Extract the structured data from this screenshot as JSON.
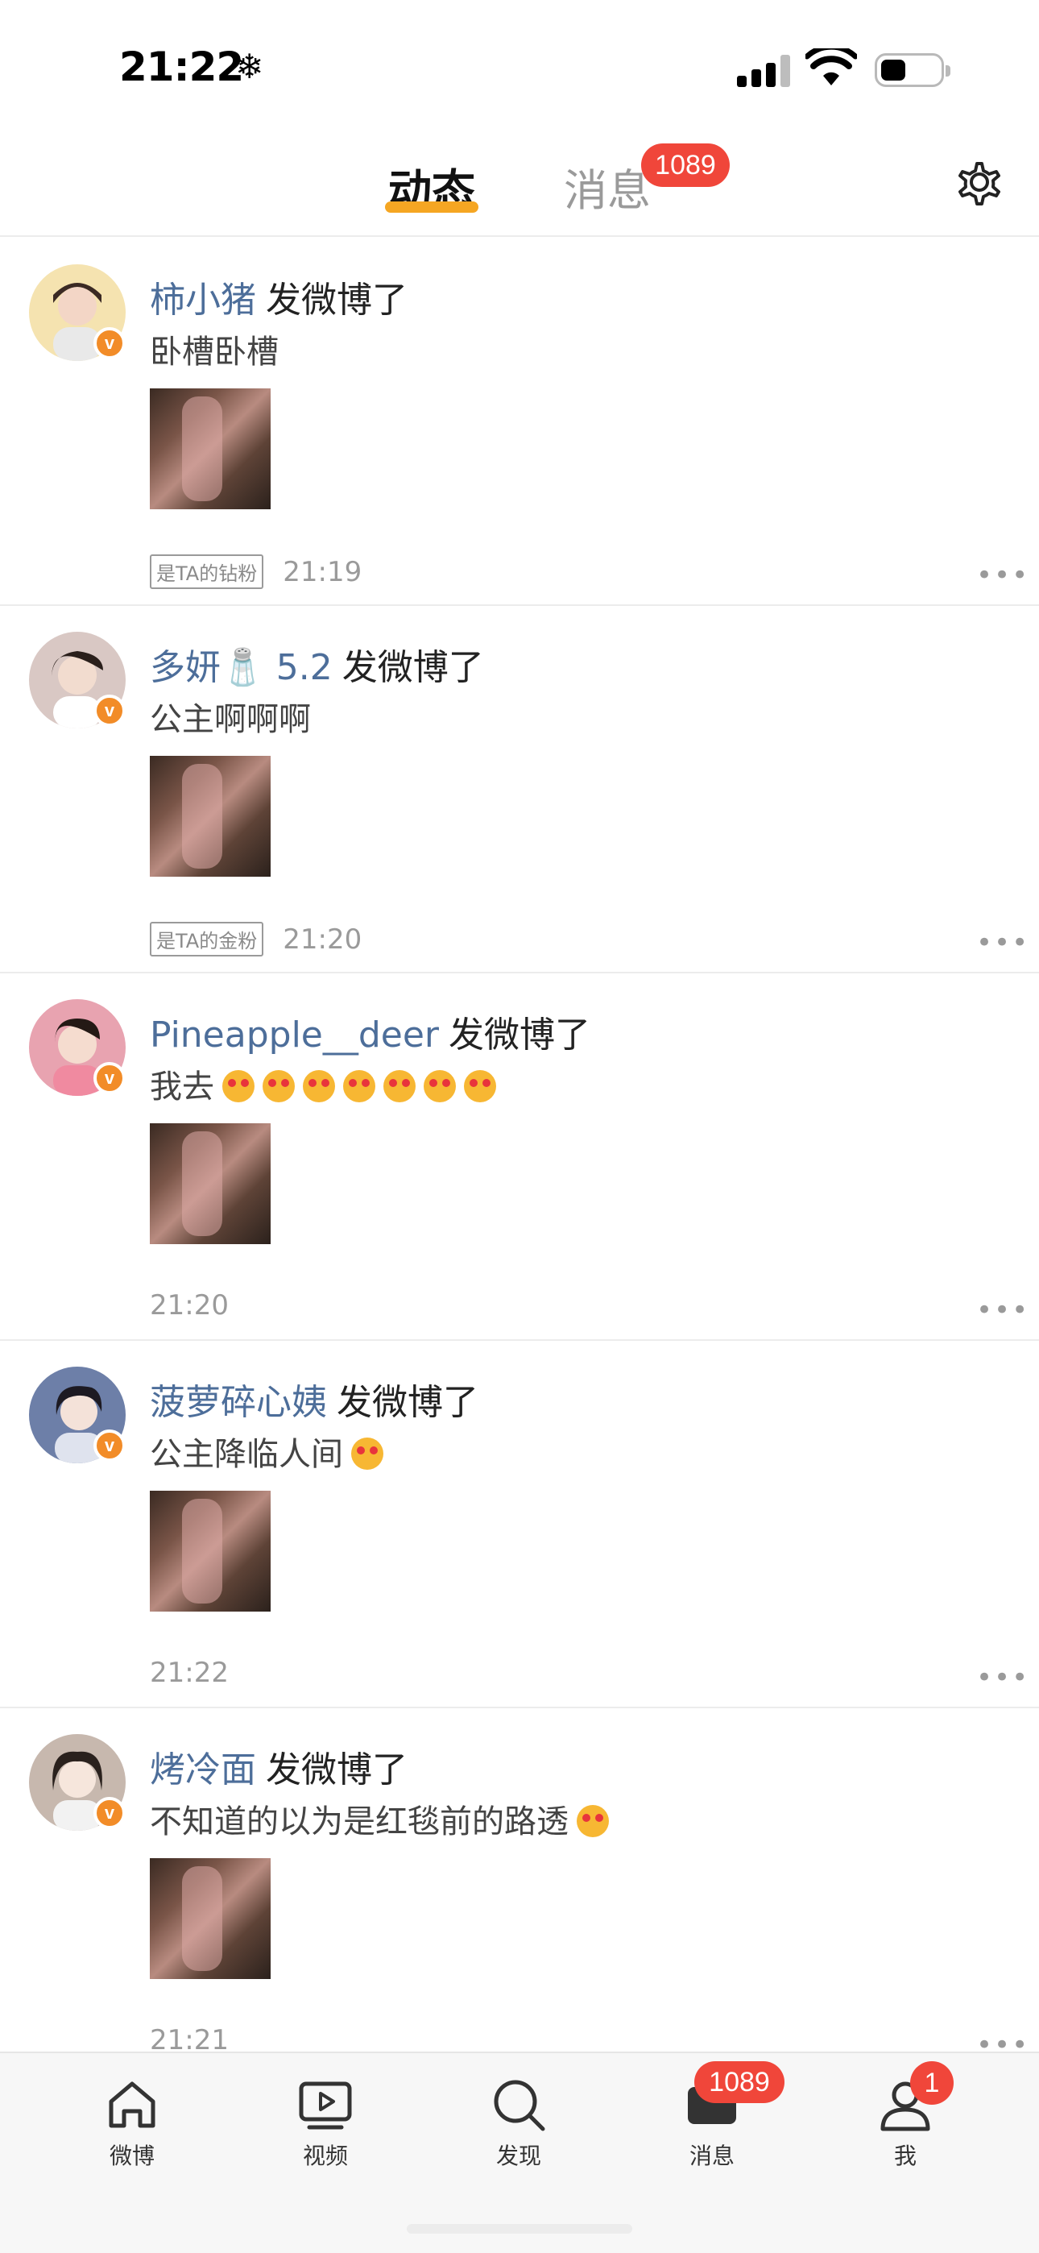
{
  "status_bar": {
    "time": "21:22",
    "weather_icon": "snowflake-icon"
  },
  "header": {
    "tabs": [
      {
        "label": "动态",
        "active": true
      },
      {
        "label": "消息",
        "active": false,
        "badge": "1089"
      }
    ],
    "settings_icon": "gear-icon"
  },
  "feed": [
    {
      "user": "柿小猪",
      "action": "发微博了",
      "text": "卧槽卧槽",
      "fan_tag": "是TA的钻粉",
      "time": "21:19",
      "avatar_color": "#f5e3b0"
    },
    {
      "user": "多妍🧂 5.2",
      "action": "发微博了",
      "text": "公主啊啊啊",
      "fan_tag": "是TA的金粉",
      "time": "21:20",
      "avatar_color": "#d9c8c4"
    },
    {
      "user": "Pineapple__deer",
      "action": "发微博了",
      "text": "我去",
      "emoji_count": 7,
      "time": "21:20",
      "avatar_color": "#e8a3b0"
    },
    {
      "user": "菠萝碎心姨",
      "action": "发微博了",
      "text": "公主降临人间",
      "emoji_count": 1,
      "time": "21:22",
      "avatar_color": "#6d7fa8"
    },
    {
      "user": "烤冷面",
      "action": "发微博了",
      "text": "不知道的以为是红毯前的路透",
      "emoji_count": 1,
      "time": "21:21",
      "avatar_color": "#c7b8ae"
    }
  ],
  "tabbar": {
    "items": [
      {
        "label": "微博",
        "icon": "home-icon"
      },
      {
        "label": "视频",
        "icon": "video-play-icon"
      },
      {
        "label": "发现",
        "icon": "search-icon"
      },
      {
        "label": "消息",
        "icon": "message-icon",
        "badge": "1089"
      },
      {
        "label": "我",
        "icon": "profile-icon",
        "badge": "1"
      }
    ]
  },
  "colors": {
    "accent": "#f5a623",
    "badge": "#f0463a",
    "username": "#4d6e9a",
    "verified": "#f28c28"
  }
}
